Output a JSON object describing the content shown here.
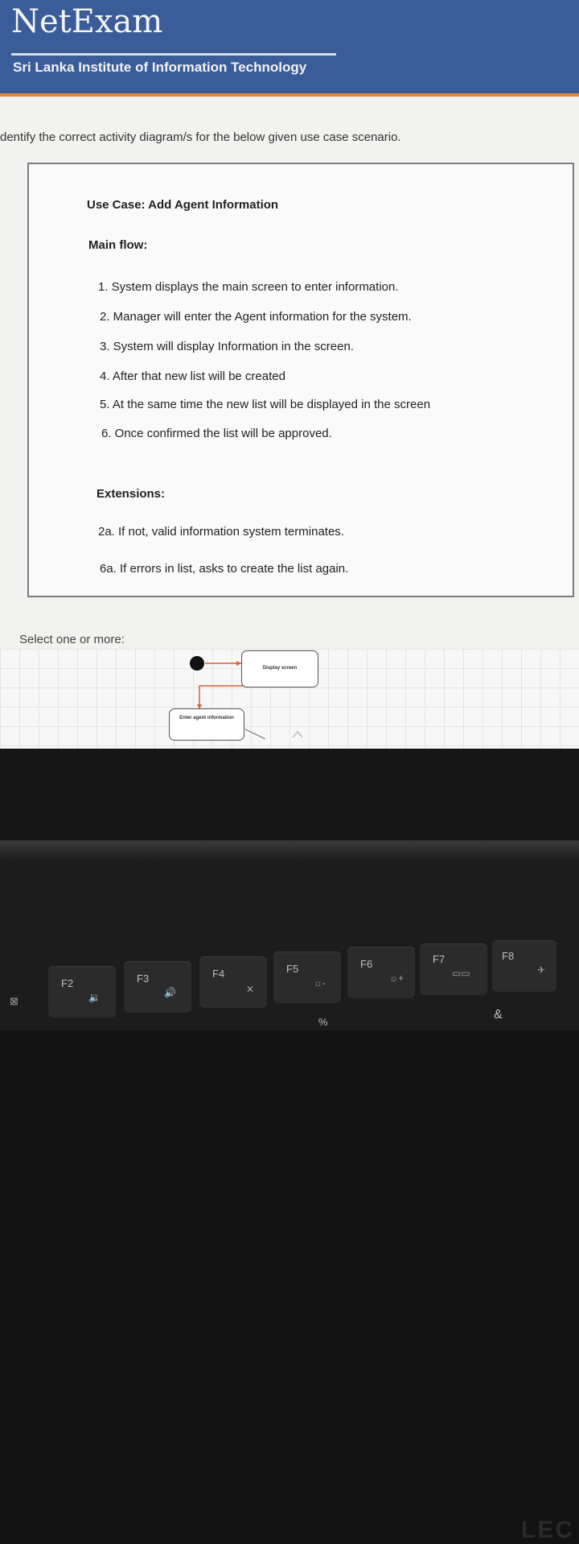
{
  "header": {
    "brand": "NetExam",
    "institute": "Sri Lanka Institute of Information Technology"
  },
  "question": {
    "prompt": "dentify the correct activity diagram/s for the below given use case scenario.",
    "use_case_label": "Use Case:",
    "use_case_title": "Add Agent Information",
    "main_flow_label": "Main flow:",
    "main_flow": [
      "1.  System displays the main screen to enter information.",
      "2.  Manager will enter the Agent information for the system.",
      "3.  System will display Information in the screen.",
      "4.  After that new list will be created",
      "5.  At the same time the new list will be displayed in the screen",
      "6.  Once confirmed the list will be approved."
    ],
    "extensions_label": "Extensions:",
    "extensions": [
      "2a. If not, valid information system terminates.",
      "6a. If errors in list, asks to create the list again."
    ]
  },
  "answers": {
    "select_label": "Select one or more:",
    "diagram_nodes": [
      "Display screen",
      "Enter agent information"
    ]
  },
  "laptop": {
    "logo": "LEC",
    "keys": [
      {
        "label": "F2",
        "icon": "🔉"
      },
      {
        "label": "F3",
        "icon": "🔊"
      },
      {
        "label": "F4",
        "icon": "✕"
      },
      {
        "label": "F5",
        "icon": "☼-"
      },
      {
        "label": "F6",
        "icon": "☼+"
      },
      {
        "label": "F7",
        "icon": "▭▭"
      },
      {
        "label": "F8",
        "icon": "✈"
      }
    ],
    "bottom_glyphs": [
      "%",
      "&"
    ]
  },
  "colors": {
    "header_bg": "#3a5d9a",
    "accent_orange": "#e08a32",
    "diagram_flow": "#d0643a"
  }
}
